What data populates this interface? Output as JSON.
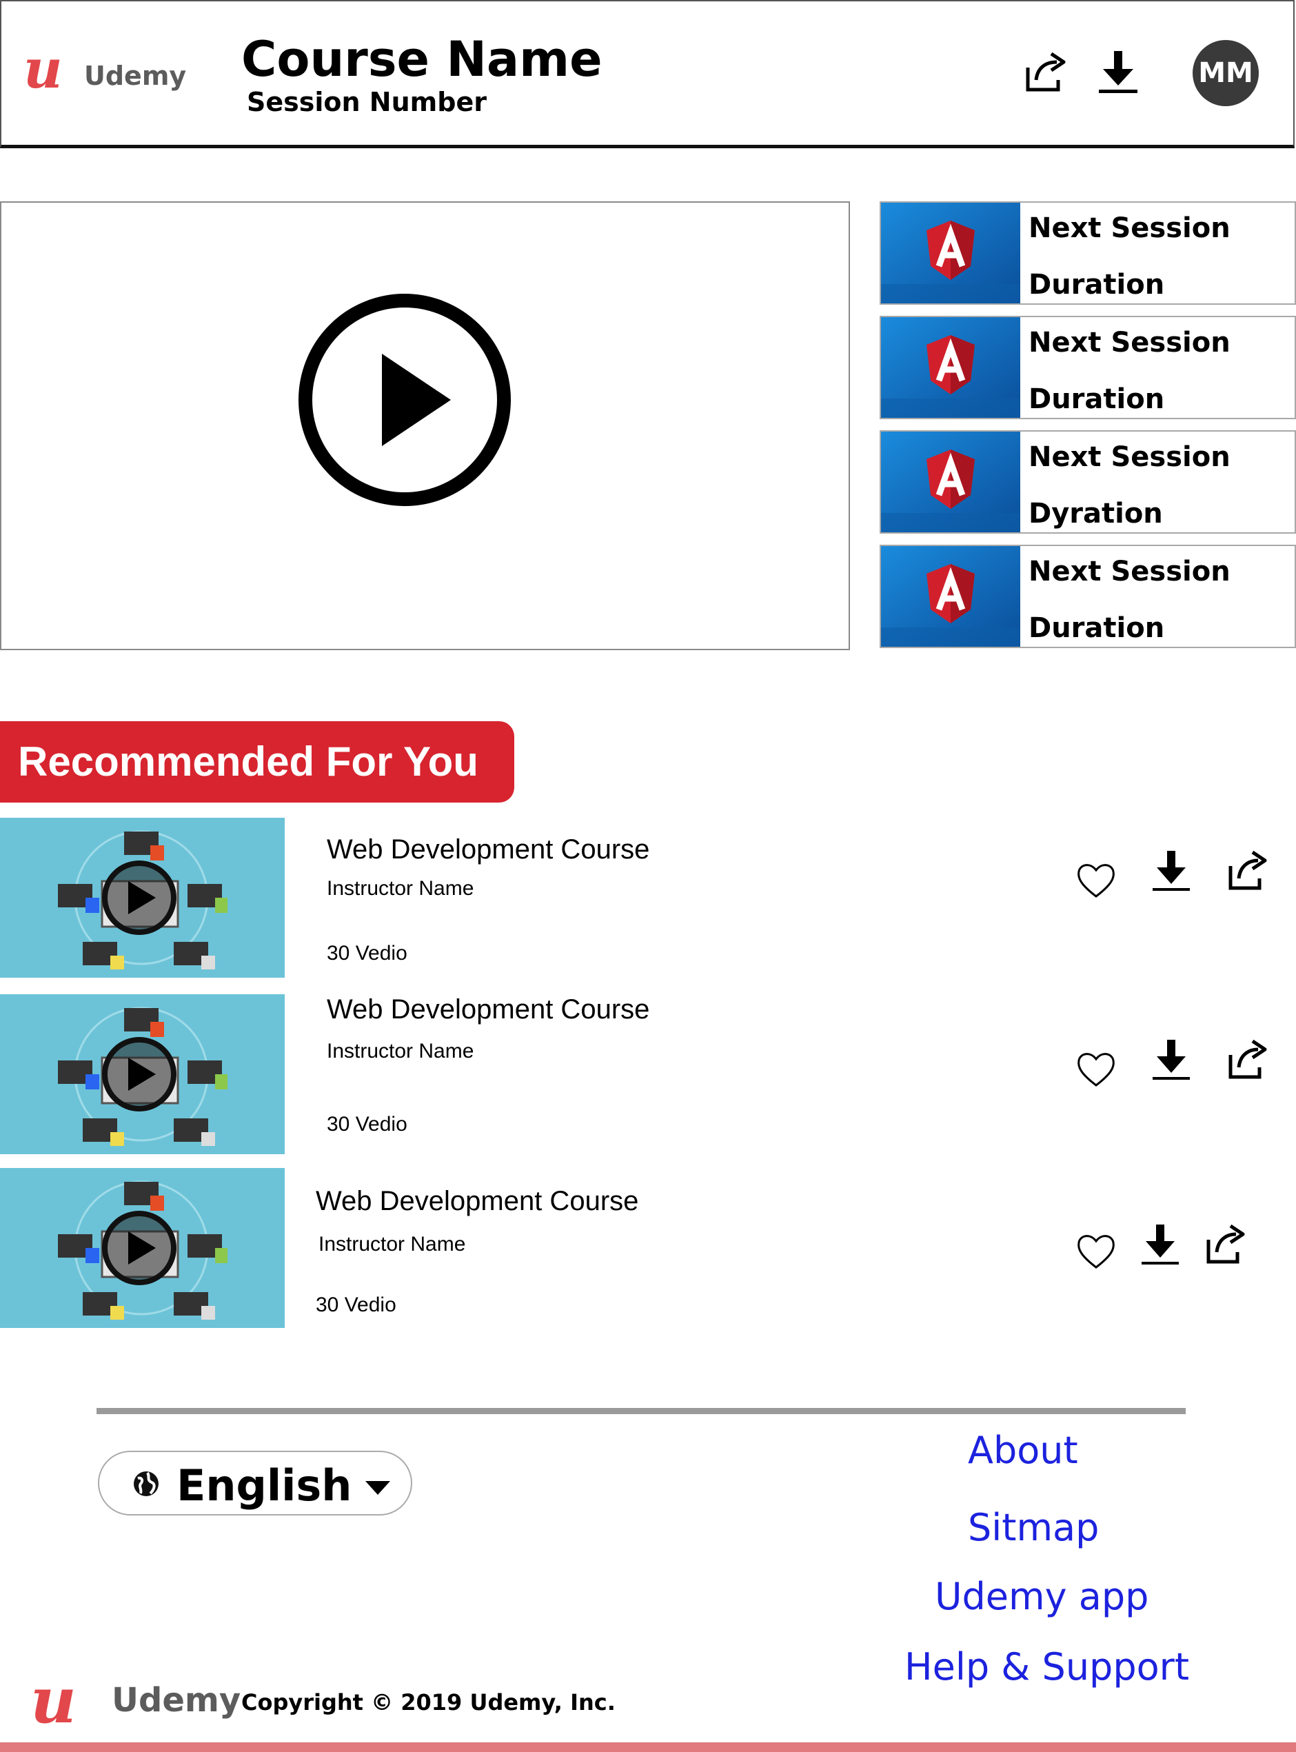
{
  "header": {
    "logo_mark": "u",
    "logo_word": "Udemy",
    "course_title": "Course Name",
    "session_number": "Session Number",
    "avatar_initials": "MM",
    "icons": [
      "share-icon",
      "download-icon"
    ]
  },
  "player": {
    "icon": "play-circle-icon"
  },
  "up_next": [
    {
      "title": "Next Session",
      "duration": "Duration",
      "thumb": "angular-logo"
    },
    {
      "title": "Next Session",
      "duration": "Duration",
      "thumb": "angular-logo"
    },
    {
      "title": "Next Session",
      "duration": "Dyration",
      "thumb": "angular-logo"
    },
    {
      "title": "Next Session",
      "duration": "Duration",
      "thumb": "angular-logo"
    }
  ],
  "recommended": {
    "heading": "Recommended For You",
    "courses": [
      {
        "title": "Web Development Course",
        "instructor": "Instructor Name",
        "videos": "30 Vedio"
      },
      {
        "title": "Web Development Course",
        "instructor": "Instructor Name",
        "videos": "30 Vedio"
      },
      {
        "title": "Web Development Course",
        "instructor": "Instructor Name",
        "videos": "30 Vedio"
      }
    ],
    "action_icons": [
      "heart-icon",
      "download-icon",
      "share-icon"
    ]
  },
  "footer": {
    "language": "English",
    "links": [
      "About",
      "Sitmap",
      "Udemy app",
      "Help & Support"
    ],
    "logo_mark": "u",
    "logo_word": "Udemy",
    "copyright": "Copyright © 2019 Udemy, Inc.",
    "colors": {
      "brand": "#e2474b",
      "banner": "#d7242f",
      "link": "#1c22dd"
    }
  }
}
